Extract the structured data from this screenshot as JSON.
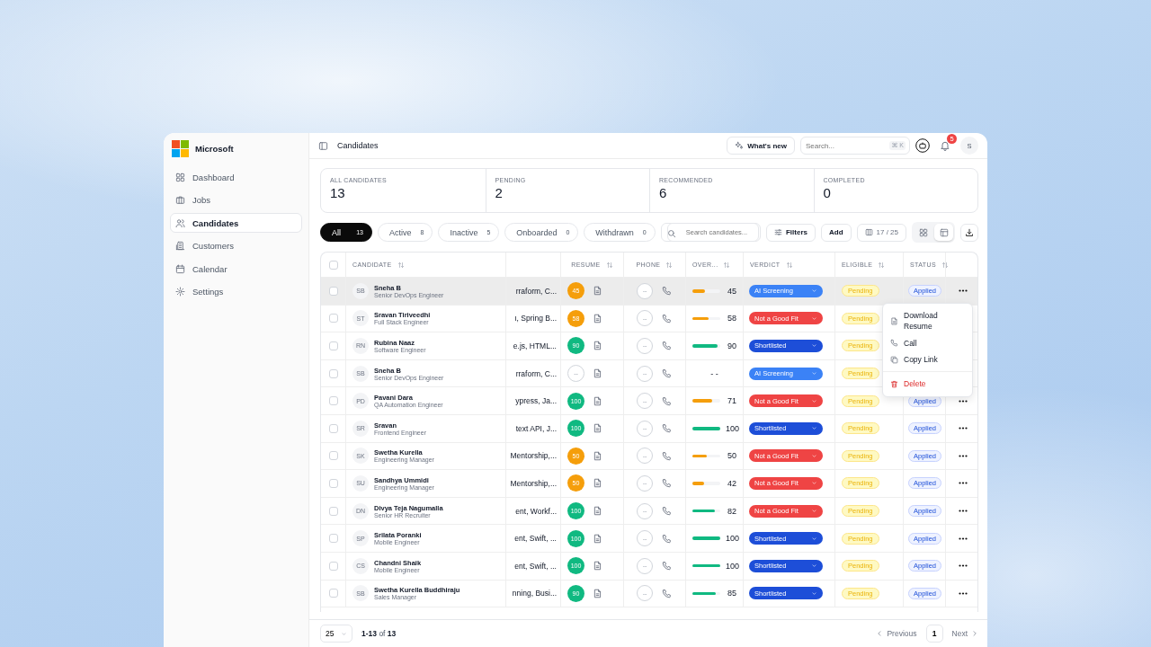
{
  "sidebar": {
    "brand": "Microsoft",
    "items": [
      {
        "label": "Dashboard",
        "selected": false
      },
      {
        "label": "Jobs",
        "selected": false
      },
      {
        "label": "Candidates",
        "selected": true
      },
      {
        "label": "Customers",
        "selected": false
      },
      {
        "label": "Calendar",
        "selected": false
      },
      {
        "label": "Settings",
        "selected": false
      }
    ]
  },
  "topbar": {
    "title": "Candidates",
    "whats_new": "What's new",
    "search": {
      "placeholder": "Search...",
      "shortcut": "⌘ K"
    },
    "notifications": "5",
    "avatar": "S"
  },
  "stats": [
    {
      "label": "ALL CANDIDATES",
      "value": "13"
    },
    {
      "label": "PENDING",
      "value": "2"
    },
    {
      "label": "RECOMMENDED",
      "value": "6"
    },
    {
      "label": "COMPLETED",
      "value": "0"
    }
  ],
  "tabs": [
    {
      "label": "All",
      "count": "13",
      "selected": true
    },
    {
      "label": "Active",
      "count": "8",
      "selected": false
    },
    {
      "label": "Inactive",
      "count": "5",
      "selected": false
    },
    {
      "label": "Onboarded",
      "count": "0",
      "selected": false
    },
    {
      "label": "Withdrawn",
      "count": "0",
      "selected": false
    }
  ],
  "toolbar": {
    "search": {
      "placeholder": "Search candidates..."
    },
    "filters": "Filters",
    "add": "Add",
    "columns": "17 / 25",
    "views": [
      {
        "selected": false
      },
      {
        "selected": true
      }
    ]
  },
  "table": {
    "select_all": {
      "checked": false
    },
    "columns": [
      {
        "kind": "check"
      },
      {
        "kind": "candidate",
        "label": "CANDIDATE"
      },
      {
        "kind": "skills"
      },
      {
        "kind": "resume",
        "label": "RESUME"
      },
      {
        "kind": "phone",
        "label": "PHONE"
      },
      {
        "kind": "overall",
        "label": "OVER..."
      },
      {
        "kind": "verdict",
        "label": "VERDICT"
      },
      {
        "kind": "eligible",
        "label": "ELIGIBLE"
      },
      {
        "kind": "status",
        "label": "STATUS"
      },
      {
        "kind": "actions"
      }
    ],
    "rows": [
      {
        "checked": false,
        "hovered": true,
        "initials": "SB",
        "name": "Sneha B",
        "role": "Senior DevOps Engineer",
        "skills": "rraform, C...",
        "resume": {
          "score": "45",
          "color": "#f59e0b"
        },
        "phone": "--",
        "overall": {
          "value": "45",
          "level": 0.45,
          "color": "#f59e0b"
        },
        "verdict": {
          "label": "AI Screening",
          "color": "#3b82f6"
        },
        "eligible": "Pending",
        "status": "Applied"
      },
      {
        "checked": false,
        "hovered": false,
        "initials": "ST",
        "name": "Sravan Tiriveedhi",
        "role": "Full Stack Engineer",
        "skills": "ı, Spring B...",
        "resume": {
          "score": "58",
          "color": "#f59e0b"
        },
        "phone": "--",
        "overall": {
          "value": "58",
          "level": 0.58,
          "color": "#f59e0b"
        },
        "verdict": {
          "label": "Not a Good Fit",
          "color": "#ef4444"
        },
        "eligible": "Pending"
      },
      {
        "checked": false,
        "hovered": false,
        "initials": "RN",
        "name": "Rubina Naaz",
        "role": "Software Engineer",
        "skills": "e.js, HTML...",
        "resume": {
          "score": "90",
          "color": "#10b981"
        },
        "phone": "--",
        "overall": {
          "value": "90",
          "level": 0.9,
          "color": "#10b981"
        },
        "verdict": {
          "label": "Shortlisted",
          "color": "#1d4ed8"
        },
        "eligible": "Pending"
      },
      {
        "checked": false,
        "hovered": false,
        "initials": "SB",
        "name": "Sneha B",
        "role": "Senior DevOps Engineer",
        "skills": "rraform, C...",
        "resume": {
          "score": "--"
        },
        "phone": "--",
        "overall": {
          "value": "- -"
        },
        "verdict": {
          "label": "AI Screening",
          "color": "#3b82f6"
        },
        "eligible": "Pending"
      },
      {
        "checked": false,
        "hovered": false,
        "initials": "PD",
        "name": "Pavani Dara",
        "role": "QA Automation Engineer",
        "skills": "ypress, Ja...",
        "resume": {
          "score": "100",
          "color": "#10b981"
        },
        "phone": "--",
        "overall": {
          "value": "71",
          "level": 0.71,
          "color": "#f59e0b"
        },
        "verdict": {
          "label": "Not a Good Fit",
          "color": "#ef4444"
        },
        "eligible": "Pending",
        "status": "Applied"
      },
      {
        "checked": false,
        "hovered": false,
        "initials": "SR",
        "name": "Sravan",
        "role": "Frontend Engineer",
        "skills": "text API, J...",
        "resume": {
          "score": "100",
          "color": "#10b981"
        },
        "phone": "--",
        "overall": {
          "value": "100",
          "level": 1,
          "color": "#10b981"
        },
        "verdict": {
          "label": "Shortlisted",
          "color": "#1d4ed8"
        },
        "eligible": "Pending",
        "status": "Applied"
      },
      {
        "checked": false,
        "hovered": false,
        "initials": "SK",
        "name": "Swetha Kurella",
        "role": "Engineering Manager",
        "skills": "Mentorship,...",
        "resume": {
          "score": "50",
          "color": "#f59e0b"
        },
        "phone": "--",
        "overall": {
          "value": "50",
          "level": 0.5,
          "color": "#f59e0b"
        },
        "verdict": {
          "label": "Not a Good Fit",
          "color": "#ef4444"
        },
        "eligible": "Pending",
        "status": "Applied"
      },
      {
        "checked": false,
        "hovered": false,
        "initials": "SU",
        "name": "Sandhya Ummidi",
        "role": "Engineering Manager",
        "skills": "Mentorship,...",
        "resume": {
          "score": "50",
          "color": "#f59e0b"
        },
        "phone": "--",
        "overall": {
          "value": "42",
          "level": 0.42,
          "color": "#f59e0b"
        },
        "verdict": {
          "label": "Not a Good Fit",
          "color": "#ef4444"
        },
        "eligible": "Pending",
        "status": "Applied"
      },
      {
        "checked": false,
        "hovered": false,
        "initials": "DN",
        "name": "Divya Teja Nagumalla",
        "role": "Senior HR Recruiter",
        "skills": "ent, Workf...",
        "resume": {
          "score": "100",
          "color": "#10b981"
        },
        "phone": "--",
        "overall": {
          "value": "82",
          "level": 0.82,
          "color": "#10b981"
        },
        "verdict": {
          "label": "Not a Good Fit",
          "color": "#ef4444"
        },
        "eligible": "Pending",
        "status": "Applied"
      },
      {
        "checked": false,
        "hovered": false,
        "initials": "SP",
        "name": "Srilata Poranki",
        "role": "Mobile Engineer",
        "skills": "ent, Swift, ...",
        "resume": {
          "score": "100",
          "color": "#10b981"
        },
        "phone": "--",
        "overall": {
          "value": "100",
          "level": 1,
          "color": "#10b981"
        },
        "verdict": {
          "label": "Shortlisted",
          "color": "#1d4ed8"
        },
        "eligible": "Pending",
        "status": "Applied"
      },
      {
        "checked": false,
        "hovered": false,
        "initials": "CS",
        "name": "Chandni Shaik",
        "role": "Mobile Engineer",
        "skills": "ent, Swift, ...",
        "resume": {
          "score": "100",
          "color": "#10b981"
        },
        "phone": "--",
        "overall": {
          "value": "100",
          "level": 1,
          "color": "#10b981"
        },
        "verdict": {
          "label": "Shortlisted",
          "color": "#1d4ed8"
        },
        "eligible": "Pending",
        "status": "Applied"
      },
      {
        "checked": false,
        "hovered": false,
        "initials": "SB",
        "name": "Swetha Kurella Buddhiraju",
        "role": "Sales Manager",
        "skills": "nning, Busi...",
        "resume": {
          "score": "90",
          "color": "#10b981"
        },
        "phone": "--",
        "overall": {
          "value": "85",
          "level": 0.85,
          "color": "#10b981"
        },
        "verdict": {
          "label": "Shortlisted",
          "color": "#1d4ed8"
        },
        "eligible": "Pending",
        "status": "Applied"
      }
    ]
  },
  "row_menu": {
    "items": [
      {
        "label": "Download Resume",
        "kind": "file"
      },
      {
        "label": "Call",
        "kind": "phone"
      },
      {
        "label": "Copy Link",
        "kind": "copy"
      },
      {
        "label": "Delete",
        "kind": "danger"
      }
    ]
  },
  "footer": {
    "page_size": "25",
    "range": "**1-13** of **13**",
    "previous": "Previous",
    "page": "1",
    "next": "Next"
  }
}
